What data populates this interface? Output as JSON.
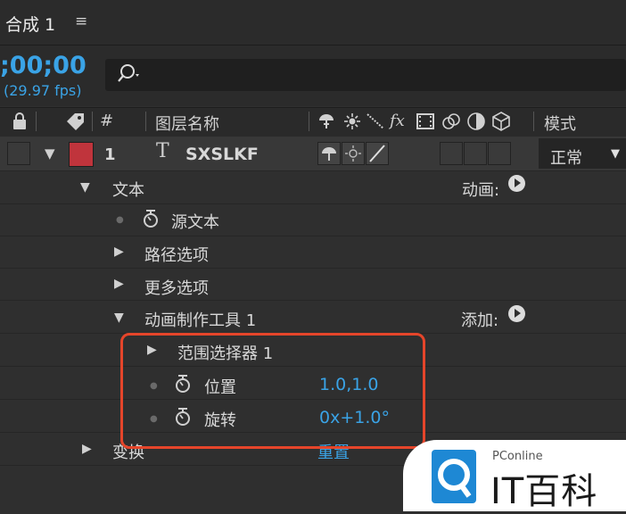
{
  "panel": {
    "comp_tab": "合成 1",
    "menu_glyph": "≡"
  },
  "timecode": {
    "value": ";00;00",
    "fps": "(29.97 fps)"
  },
  "search": {
    "icon": "search-icon",
    "placeholder": ""
  },
  "header": {
    "number": "#",
    "layer_name": "图层名称",
    "switch_fx": "fx",
    "mode": "模式"
  },
  "layer": {
    "number": "1",
    "type_glyph": "T",
    "name": "SXSLKF",
    "label_color": "#c0343c",
    "mode": "正常"
  },
  "tree": {
    "text_group": "文本",
    "animate_label": "动画:",
    "source_text": "源文本",
    "path_options": "路径选项",
    "more_options": "更多选项",
    "animator": "动画制作工具 1",
    "add_label": "添加:",
    "range_selector": "范围选择器 1",
    "position_label": "位置",
    "position_value": "1.0,1.0",
    "rotation_label": "旋转",
    "rotation_value": "0x+1.0°",
    "transform": "变换",
    "reset": "重置"
  },
  "watermark": {
    "brand": "PConline",
    "name": "IT百科"
  },
  "colors": {
    "accent": "#3aa3e6",
    "highlight": "#e5452a"
  }
}
